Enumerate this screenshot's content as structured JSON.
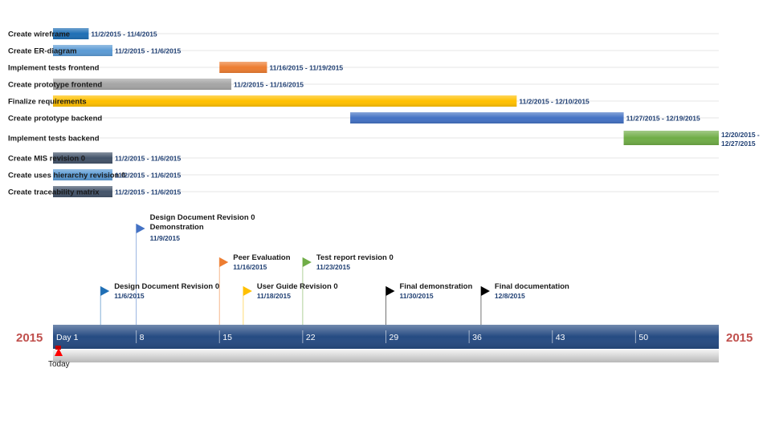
{
  "chart_data": {
    "type": "gantt",
    "tasks": [
      {
        "name": "Create wireframe",
        "start_day": 1,
        "end_day": 3,
        "dates": "11/2/2015 - 11/4/2015",
        "color": "#1f6fb5"
      },
      {
        "name": "Create ER-diagram",
        "start_day": 1,
        "end_day": 5,
        "dates": "11/2/2015 - 11/6/2015",
        "color": "#5b9bd5"
      },
      {
        "name": "Implement tests frontend",
        "start_day": 15,
        "end_day": 18,
        "dates": "11/16/2015 - 11/19/2015",
        "color": "#ed7d31"
      },
      {
        "name": "Create prototype frontend",
        "start_day": 1,
        "end_day": 15,
        "dates": "11/2/2015 - 11/16/2015",
        "color": "#a5a5a5"
      },
      {
        "name": "Finalize requirements",
        "start_day": 1,
        "end_day": 39,
        "dates": "11/2/2015 - 12/10/2015",
        "color": "#ffc000"
      },
      {
        "name": "Create prototype backend",
        "start_day": 26,
        "end_day": 48,
        "dates": "11/27/2015 - 12/19/2015",
        "color": "#4472c4"
      },
      {
        "name": "Implement tests backend",
        "start_day": 49,
        "end_day": 56,
        "dates": "12/20/2015 -",
        "dates2": "12/27/2015",
        "color": "#70ad47"
      },
      {
        "name": "Create MIS revision 0",
        "start_day": 1,
        "end_day": 5,
        "dates": "11/2/2015 - 11/6/2015",
        "color": "#44546a"
      },
      {
        "name": "Create uses hierarchy revision 0",
        "start_day": 1,
        "end_day": 5,
        "dates": "11/2/2015 - 11/6/2015",
        "color": "#5b9bd5"
      },
      {
        "name": "Create traceability matrix",
        "start_day": 1,
        "end_day": 5,
        "dates": "11/2/2015 - 11/6/2015",
        "color": "#44546a"
      }
    ],
    "milestones": [
      {
        "title": "Design Document Revision 0",
        "title2": "Demonstration",
        "date": "11/9/2015",
        "day": 8,
        "color": "#4472c4",
        "level": 0
      },
      {
        "title": "Peer Evaluation",
        "date": "11/16/2015",
        "day": 15,
        "color": "#ed7d31",
        "level": 1
      },
      {
        "title": "Test report revision 0",
        "date": "11/23/2015",
        "day": 22,
        "color": "#70ad47",
        "level": 1
      },
      {
        "title": "Design Document Revision 0",
        "date": "11/6/2015",
        "day": 5,
        "color": "#1f6fb5",
        "level": 2
      },
      {
        "title": "User Guide Revision 0",
        "date": "11/18/2015",
        "day": 17,
        "color": "#ffc000",
        "level": 2
      },
      {
        "title": "Final demonstration",
        "date": "11/30/2015",
        "day": 29,
        "color": "#000000",
        "level": 2
      },
      {
        "title": "Final documentation",
        "date": "12/8/2015",
        "day": 37,
        "color": "#000000",
        "level": 2
      }
    ],
    "timeline": {
      "ticks": [
        {
          "day": 1,
          "label": "Day 1"
        },
        {
          "day": 8,
          "label": "8"
        },
        {
          "day": 15,
          "label": "15"
        },
        {
          "day": 22,
          "label": "22"
        },
        {
          "day": 29,
          "label": "29"
        },
        {
          "day": 36,
          "label": "36"
        },
        {
          "day": 43,
          "label": "43"
        },
        {
          "day": 50,
          "label": "50"
        }
      ],
      "x_range": [
        1,
        57
      ],
      "year_left": "2015",
      "year_right": "2015",
      "today_label": "Today",
      "today_day": 1,
      "bar_color": "#264b82"
    }
  }
}
